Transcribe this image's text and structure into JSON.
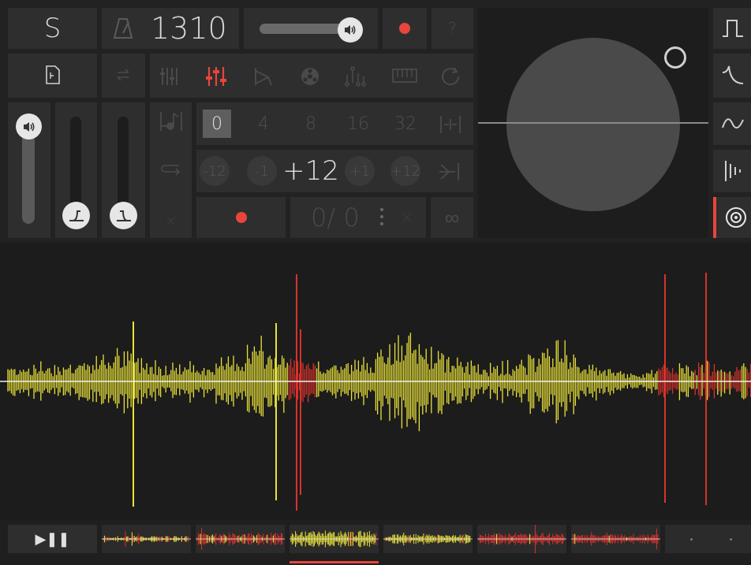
{
  "app": {
    "mode_letter": "S",
    "tempo": "1310",
    "help": "?",
    "record_dot": "●"
  },
  "quantize": {
    "options": [
      "0",
      "4",
      "8",
      "16",
      "32"
    ],
    "selected": "0"
  },
  "pitch": {
    "buttons": [
      "-12",
      "-1",
      "+1",
      "+12"
    ],
    "value": "+12"
  },
  "loop": {
    "counter": "0/ 0",
    "clear": "×",
    "infinite": "∞"
  },
  "transport": {
    "play_pause": "▶❚❚"
  },
  "volume": {
    "level": 0.86
  },
  "colors": {
    "accent_red": "#e8453c",
    "waveform_yellow": "#e9e23a",
    "waveform_red": "#d8322c",
    "panel": "#2e2e2e",
    "background": "#1c1c1c"
  },
  "waveform_icons": [
    "square-wave-icon",
    "decay-wave-icon",
    "sine-wave-icon",
    "pulse-wave-icon",
    "target-icon"
  ]
}
